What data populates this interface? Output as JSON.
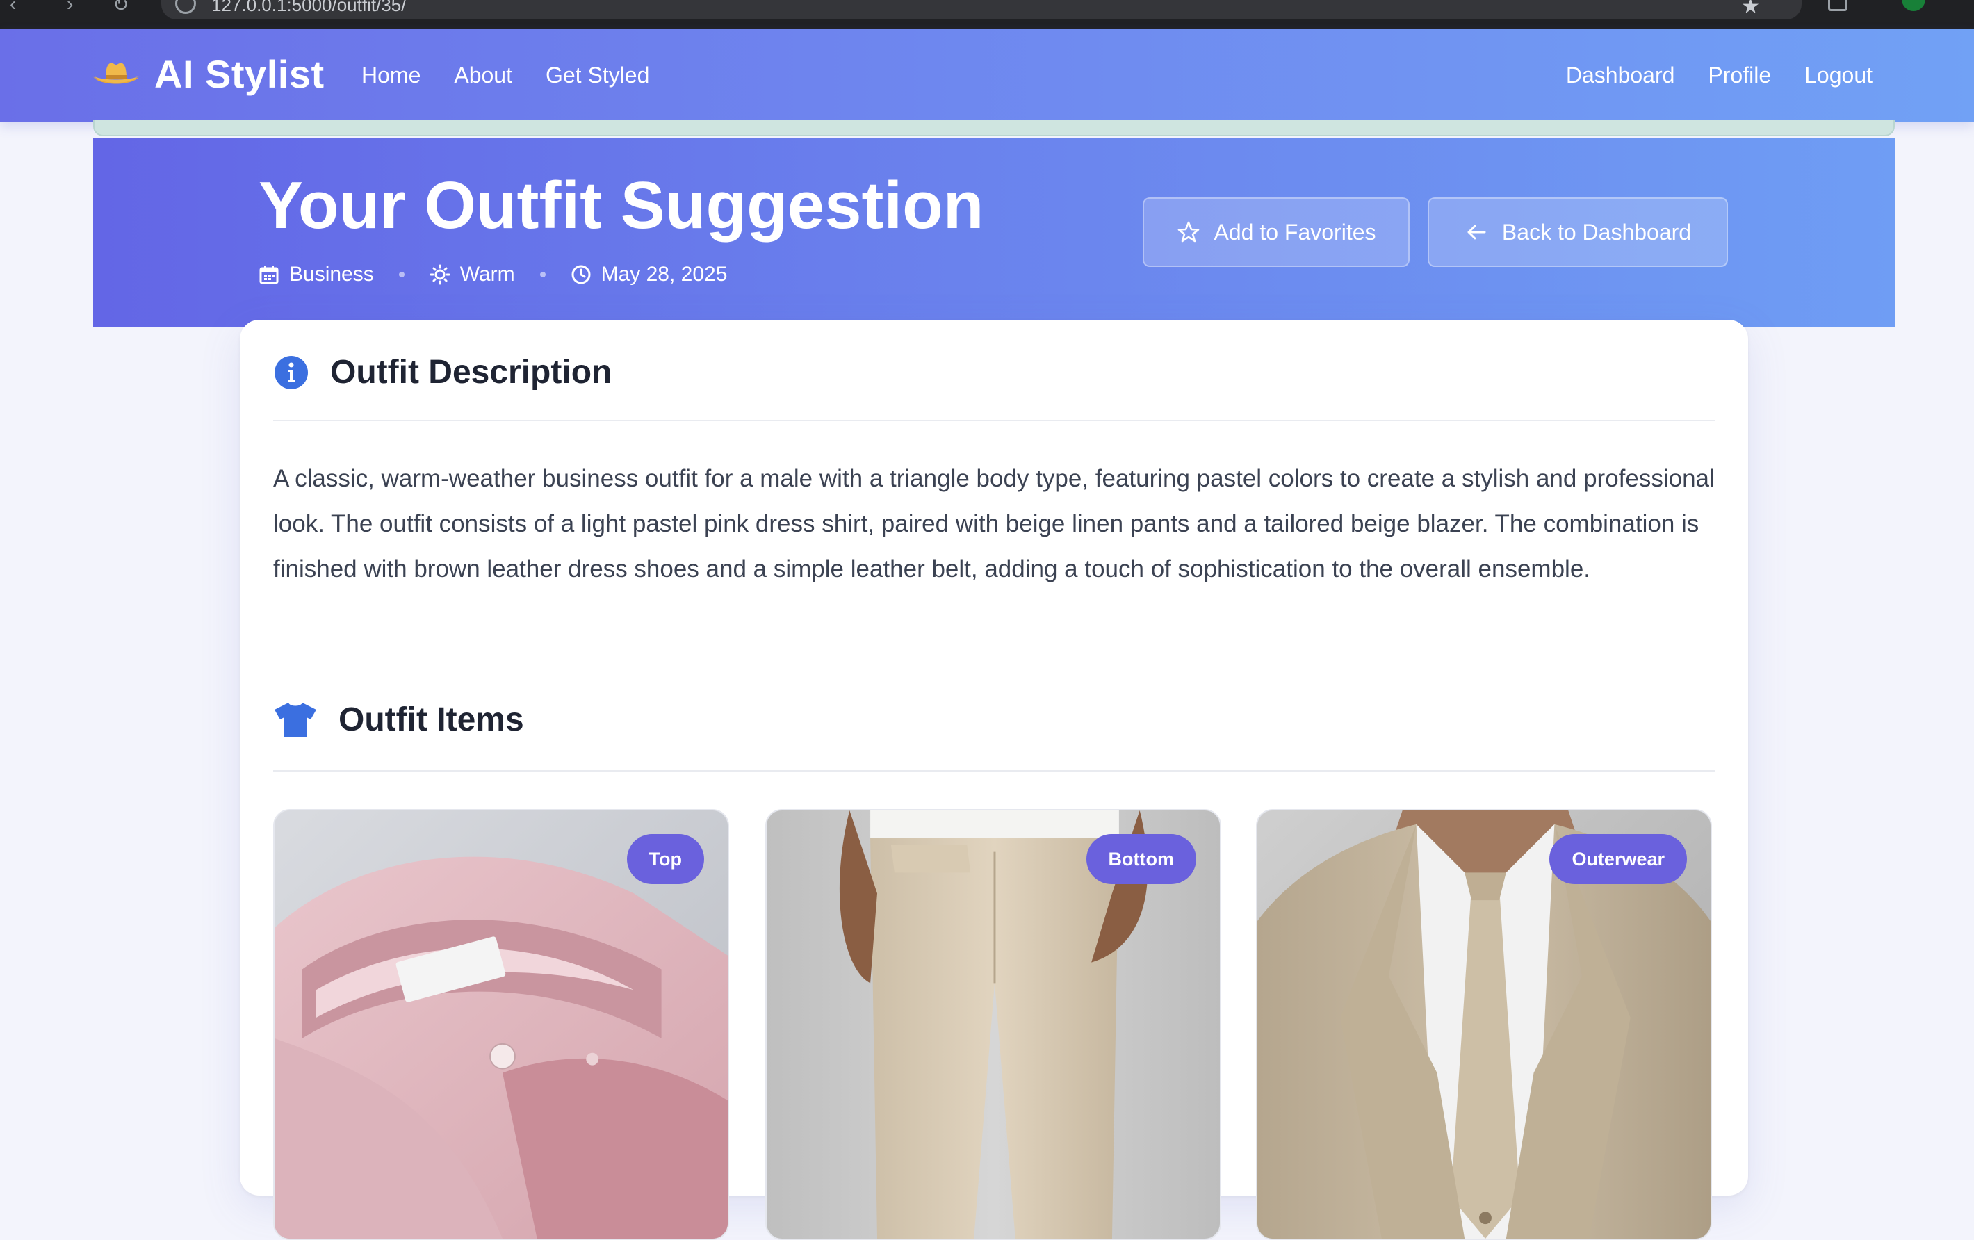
{
  "browser": {
    "url": "127.0.0.1:5000/outfit/35/"
  },
  "nav": {
    "brand": "AI Stylist",
    "left_links": [
      "Home",
      "About",
      "Get Styled"
    ],
    "right_links": [
      "Dashboard",
      "Profile",
      "Logout"
    ]
  },
  "hero": {
    "title": "Your Outfit Suggestion",
    "meta": {
      "occasion": "Business",
      "weather": "Warm",
      "date": "May 28, 2025"
    },
    "favorite_label": "Add to Favorites",
    "back_label": "Back to Dashboard"
  },
  "description": {
    "title": "Outfit Description",
    "text": "A classic, warm-weather business outfit for a male with a triangle body type, featuring pastel colors to create a stylish and professional look. The outfit consists of a light pastel pink dress shirt, paired with beige linen pants and a tailored beige blazer. The combination is finished with brown leather dress shoes and a simple leather belt, adding a touch of sophistication to the overall ensemble."
  },
  "items": {
    "title": "Outfit Items",
    "list": [
      {
        "category": "Top"
      },
      {
        "category": "Bottom"
      },
      {
        "category": "Outerwear"
      }
    ]
  },
  "colors": {
    "accent": "#6a61dd",
    "brand_icon": "#f0b94a",
    "section_icon": "#3b6fe0",
    "text": "#1f2433"
  }
}
